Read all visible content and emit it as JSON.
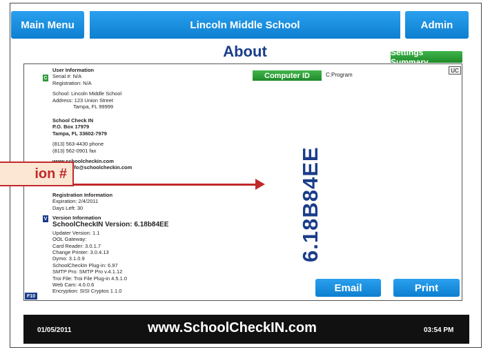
{
  "header": {
    "main_menu": "Main Menu",
    "school": "Lincoln Middle School",
    "admin": "Admin"
  },
  "page_title": "About",
  "settings_summary": "Settings Summary",
  "uc": "UC",
  "computer_id": {
    "label": "Computer ID",
    "value": "C:Program"
  },
  "user_info": {
    "heading": "User Information",
    "serial": "Serial #: N/A",
    "registration": "Registration: N/A",
    "school": "School: Lincoln Middle School",
    "address1": "Address: 123 Union Street",
    "address2": "Tampa, FL 99999"
  },
  "company": {
    "name": "School Check IN",
    "po": "P.O. Box 17979",
    "city": "Tampa, FL 33602-7979",
    "phone": "(813) 563-4430 phone",
    "fax": "(813) 562-0901 fax",
    "web": "www.schoolcheckin.com",
    "email": "Email: info@schoolcheckin.com"
  },
  "registration_info": {
    "heading": "Registration Information",
    "expiration": "Expiration: 2/4/2011",
    "days_left": "Days Left: 30"
  },
  "version_info": {
    "heading": "Version Information",
    "schoolcheckin": "SchoolCheckIN Version: 6.18b84EE",
    "updater": "Updater Version: 1.1",
    "ool": "OOL Gateway:",
    "card_reader": "Card Reader: 3.0.1.7",
    "change_printer": "Change Printer: 3.0.4.13",
    "dymo": "Dymo: 3.1.0.9",
    "plugin": "SchoolCheckIn Plug-in: 6.97",
    "smtp": "SMTP Pro: SMTP Pro v.4.1.12",
    "troi": "Troi File: Troi File Plug-in 4.5.1.0",
    "webcam": "Web Cam: 4.0.0.6",
    "encryption": "Encryption: SISI Cryptos 1.1.0"
  },
  "version_big": "6.18B84EE",
  "buttons": {
    "email": "Email",
    "print": "Print",
    "f10": "F10"
  },
  "callout": "ion #",
  "footer": {
    "date": "01/05/2011",
    "site": "www.SchoolCheckIN.com",
    "time": "03:54 PM"
  }
}
